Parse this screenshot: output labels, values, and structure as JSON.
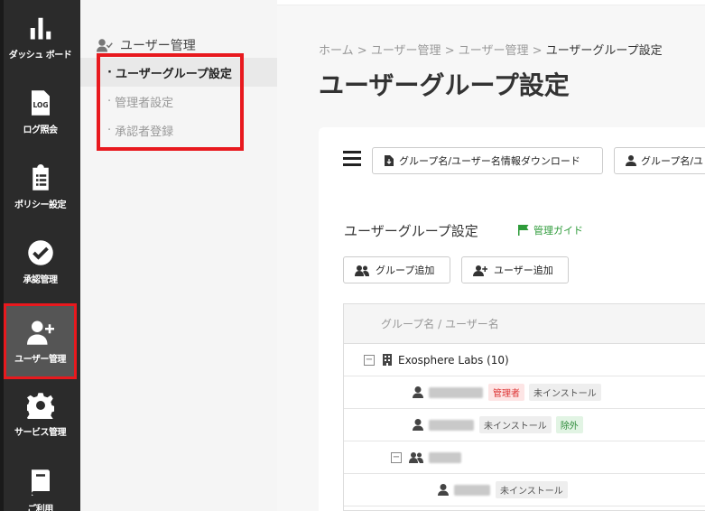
{
  "rail": [
    {
      "label": "ダッシュ ボード",
      "icon": "bar-chart-icon"
    },
    {
      "label": "ログ照会",
      "icon": "log-file-icon",
      "badge": "LOG"
    },
    {
      "label": "ポリシー設定",
      "icon": "clipboard-list-icon"
    },
    {
      "label": "承認管理",
      "icon": "check-circle-icon"
    },
    {
      "label": "ユーザー管理",
      "icon": "user-plus-icon",
      "active": true
    },
    {
      "label": "サービス管理",
      "icon": "gear-icon"
    },
    {
      "label": "ご利用",
      "icon": "book-icon"
    }
  ],
  "subnav": {
    "header": "ユーザー管理",
    "items": [
      {
        "label": "ユーザーグループ設定",
        "active": true
      },
      {
        "label": "管理者設定"
      },
      {
        "label": "承認者登録"
      }
    ]
  },
  "breadcrumb": {
    "home": "ホーム",
    "level1": "ユーザー管理",
    "level2": "ユーザー管理",
    "current": "ユーザーグループ設定",
    "separator": ">"
  },
  "page_title": "ユーザーグループ設定",
  "toolbar": {
    "download_label": "グループ名/ユーザー名情報ダウンロード",
    "upload_label": "グループ名/ユ"
  },
  "section": {
    "title": "ユーザーグループ設定",
    "guide_label": "管理ガイド",
    "add_group_label": "グループ追加",
    "add_user_label": "ユーザー追加"
  },
  "table": {
    "header": "グループ名 / ユーザー名",
    "group_name": "Exosphere Labs (10)",
    "rows": [
      {
        "tags": [
          "管理者",
          "未インストール"
        ]
      },
      {
        "tags": [
          "未インストール",
          "除外"
        ]
      },
      {
        "tags": []
      },
      {
        "tags": [
          "未インストール"
        ]
      }
    ]
  },
  "colors": {
    "rail_bg": "#2b2b2b",
    "highlight": "#e8191e",
    "guide_green": "#2e9b3a",
    "admin_tag": "#d33333"
  }
}
